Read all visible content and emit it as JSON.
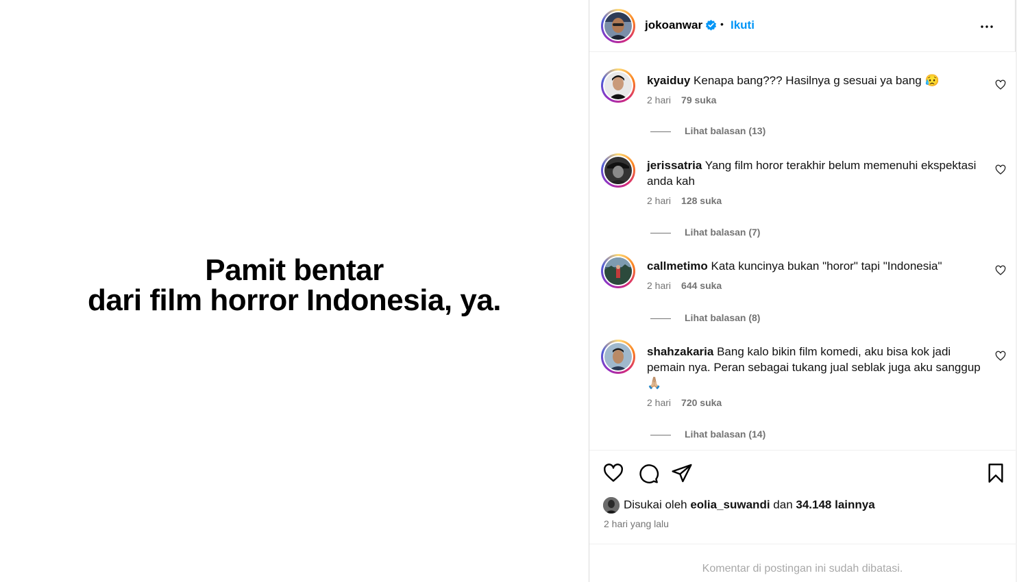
{
  "post": {
    "image_text_line1": "Pamit bentar",
    "image_text_line2": "dari film horror Indonesia, ya."
  },
  "header": {
    "username": "jokoanwar",
    "separator": "•",
    "follow_label": "Ikuti"
  },
  "comments": [
    {
      "user": "kyaiduy",
      "text": "Kenapa bang??? Hasilnya g sesuai ya bang 😥",
      "time": "2 hari",
      "likes": "79 suka",
      "replies": "Lihat balasan (13)"
    },
    {
      "user": "jerissatria",
      "text": "Yang film horor terakhir belum memenuhi ekspektasi anda kah",
      "time": "2 hari",
      "likes": "128 suka",
      "replies": "Lihat balasan (7)"
    },
    {
      "user": "callmetimo",
      "text": "Kata kuncinya bukan \"horor\" tapi \"Indonesia\"",
      "time": "2 hari",
      "likes": "644 suka",
      "replies": "Lihat balasan (8)"
    },
    {
      "user": "shahzakaria",
      "text": "Bang kalo bikin film komedi, aku bisa kok jadi pemain nya. Peran sebagai tukang jual seblak juga aku sanggup 🙏🏼",
      "time": "2 hari",
      "likes": "720 suka",
      "replies": "Lihat balasan (14)"
    }
  ],
  "footer": {
    "liked_prefix": "Disukai oleh",
    "liked_user": "eolia_suwandi",
    "liked_mid": "dan",
    "liked_count": "34.148 lainnya",
    "time_ago": "2 hari yang lalu",
    "comments_limited": "Komentar di postingan ini sudah dibatasi."
  },
  "colors": {
    "link": "#0095f6",
    "muted": "#737373",
    "verified": "#0095f6"
  }
}
